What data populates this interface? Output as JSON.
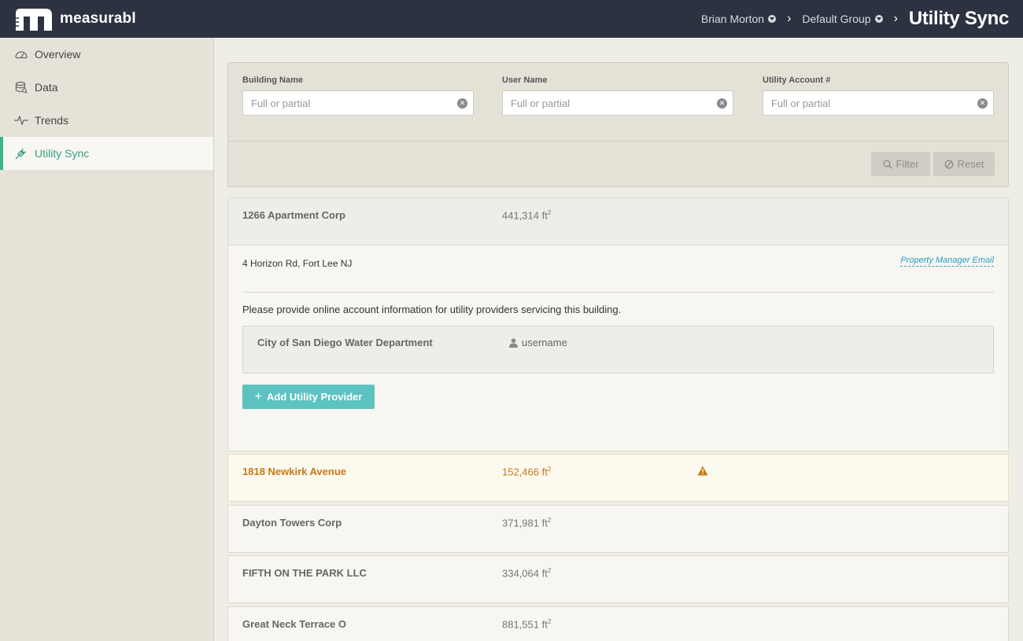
{
  "app": {
    "brand": "measurabl"
  },
  "breadcrumb": {
    "user": "Brian Morton",
    "group": "Default Group",
    "current": "Utility Sync"
  },
  "sidebar": {
    "items": [
      {
        "label": "Overview",
        "icon": "gauge-icon"
      },
      {
        "label": "Data",
        "icon": "database-icon"
      },
      {
        "label": "Trends",
        "icon": "pulse-icon"
      },
      {
        "label": "Utility Sync",
        "icon": "plug-icon",
        "active": true
      }
    ]
  },
  "filters": {
    "building": {
      "label": "Building Name",
      "placeholder": "Full or partial"
    },
    "user": {
      "label": "User Name",
      "placeholder": "Full or partial"
    },
    "account": {
      "label": "Utility Account #",
      "placeholder": "Full or partial"
    },
    "filter_label": "Filter",
    "reset_label": "Reset"
  },
  "buildings": [
    {
      "name": "1266 Apartment Corp",
      "area": "441,314 ft",
      "area_sup": "2",
      "expanded": true,
      "address": "4 Horizon Rd, Fort Lee NJ",
      "pm_email_label": "Property Manager Email",
      "prompt": "Please provide online account information for utility providers servicing this building.",
      "provider": {
        "name": "City of San Diego Water Department",
        "username": "username"
      },
      "add_provider_label": "Add Utility Provider"
    },
    {
      "name": "1818 Newkirk Avenue",
      "area": "152,466 ft",
      "area_sup": "2",
      "warning": true
    },
    {
      "name": "Dayton Towers Corp",
      "area": "371,981 ft",
      "area_sup": "2"
    },
    {
      "name": "FIFTH ON THE PARK LLC",
      "area": "334,064 ft",
      "area_sup": "2"
    },
    {
      "name": "Great Neck Terrace O",
      "area": "881,551 ft",
      "area_sup": "2"
    }
  ],
  "colors": {
    "topbar": "#2c3240",
    "accent": "#3bb58e",
    "add_button": "#5cc3c1",
    "warning": "#c87a16",
    "link": "#2aa0c8"
  }
}
